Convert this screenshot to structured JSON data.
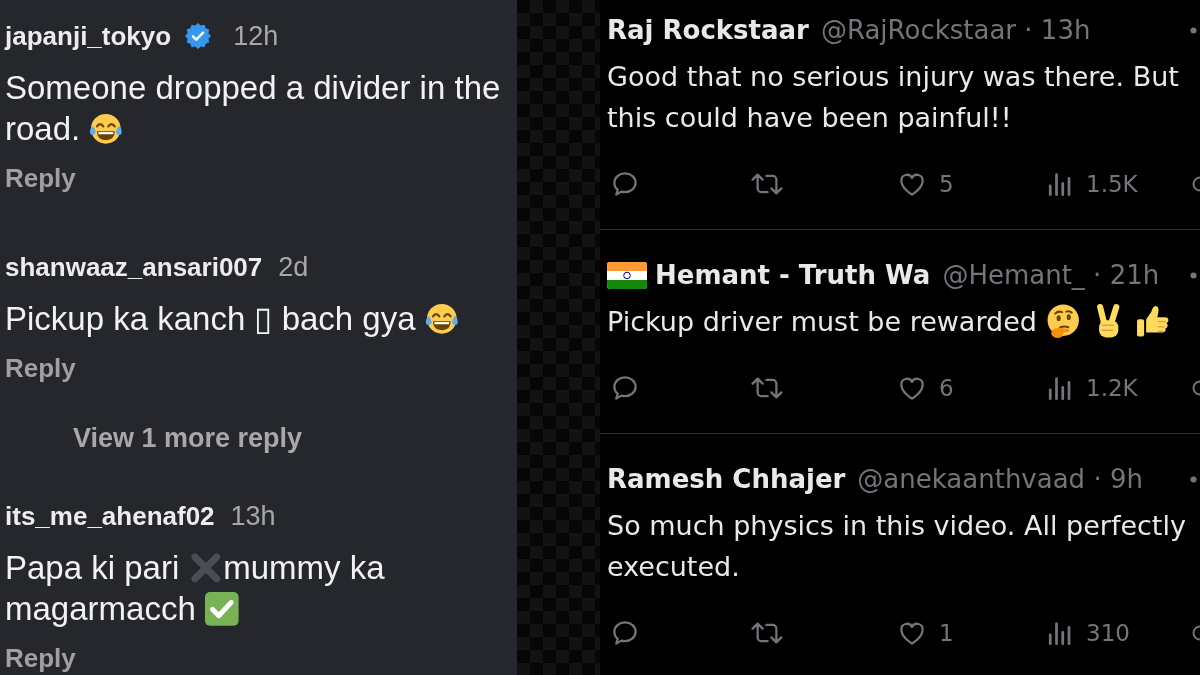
{
  "comments_panel": {
    "comments": [
      {
        "username": "japanji_tokyo",
        "verified": true,
        "time": "12h",
        "body": [
          {
            "kind": "text",
            "text": "Someone dropped a divider in the road."
          },
          {
            "kind": "laughing"
          }
        ],
        "reply_label": "Reply"
      },
      {
        "username": "shanwaaz_ansari007",
        "verified": false,
        "time": "2d",
        "body": [
          {
            "kind": "text",
            "text": "Pickup ka kanch ▯ bach gya"
          },
          {
            "kind": "laughing"
          }
        ],
        "reply_label": "Reply",
        "more_replies": "View 1 more reply"
      },
      {
        "username": "its_me_ahenaf02",
        "verified": false,
        "time": "13h",
        "body": [
          {
            "kind": "text",
            "text": "Papa ki pari"
          },
          {
            "kind": "cross"
          },
          {
            "kind": "text",
            "text": "mummy ka magarmacch"
          },
          {
            "kind": "check"
          }
        ],
        "reply_label": "Reply"
      }
    ]
  },
  "tweets_panel": {
    "tweets": [
      {
        "name": "Raj Rockstaar",
        "flag": false,
        "meta": "@RajRockstaar · 13h",
        "body": [
          {
            "kind": "text",
            "text": "Good that no serious injury was there. But this could have been painful!!"
          }
        ],
        "likes": "5",
        "views": "1.5K"
      },
      {
        "name": "Hemant - Truth Wa",
        "flag": true,
        "meta": "@Hemant_ · 21h",
        "body": [
          {
            "kind": "text",
            "text": "Pickup driver must be rewarded"
          },
          {
            "kind": "thinking"
          },
          {
            "kind": "peace"
          },
          {
            "kind": "thumbsup"
          }
        ],
        "likes": "6",
        "views": "1.2K"
      },
      {
        "name": "Ramesh Chhajer",
        "flag": false,
        "meta": "@anekaanthvaad · 9h",
        "body": [
          {
            "kind": "text",
            "text": "So much physics in this video. All perfectly executed."
          }
        ],
        "likes": "1",
        "views": "310"
      }
    ]
  }
}
